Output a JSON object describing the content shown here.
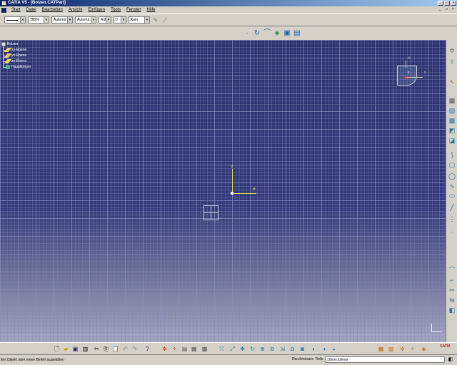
{
  "window": {
    "title": "CATIA V5 - [Bolzen.CATPart]",
    "app_icon_glyph": "C",
    "controls": [
      "_",
      "□",
      "×"
    ]
  },
  "menubar": {
    "items": [
      "Start",
      "Datei",
      "Bearbeiten",
      "Ansicht",
      "Einfügen",
      "Tools",
      "Fenster",
      "Hilfe"
    ],
    "mdi_controls": [
      "_",
      "□",
      "×"
    ]
  },
  "toolbar1": {
    "color_value": "",
    "transparency_value": "100%",
    "linetype_value": "Automa",
    "lineweight_value": "Automa",
    "point_value": "Aut",
    "layer_number": "0",
    "layer_name": "Kein"
  },
  "tree": {
    "root": "Bolzen",
    "children": [
      "xy-Ebene",
      "yz-Ebene",
      "zx-Ebene",
      "Hauptkörper"
    ]
  },
  "compass": {
    "y_label": "y",
    "z_label": "z",
    "x_label": "x"
  },
  "sketch_axes": {
    "v_label": "V",
    "h_label": "H"
  },
  "statusbar": {
    "message": "Ein Objekt oder einen Befehl auswählen",
    "field_label": "Durchmesser: Tiefe",
    "field_value": "10mm;10mm"
  },
  "logo": {
    "text": "CATIA"
  },
  "colors": {
    "viewport_top": "#2e3370",
    "viewport_bottom": "#a7a8c0",
    "axis": "#e8e050",
    "title_bar": "#0a246a"
  }
}
